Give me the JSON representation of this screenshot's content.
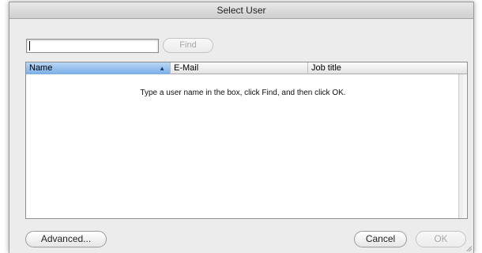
{
  "window": {
    "title": "Select User"
  },
  "search": {
    "value": "",
    "placeholder": ""
  },
  "buttons": {
    "find": "Find",
    "advanced": "Advanced...",
    "cancel": "Cancel",
    "ok": "OK"
  },
  "table": {
    "columns": [
      {
        "label": "Name",
        "sorted": true
      },
      {
        "label": "E-Mail",
        "sorted": false
      },
      {
        "label": "Job title",
        "sorted": false
      }
    ],
    "hint": "Type a user name in the box, click Find, and then click OK."
  },
  "colors": {
    "sorted_header": "#7aaee8",
    "disabled_text": "#a8a8a8"
  },
  "icons": {
    "sort": "sort-ascending-icon",
    "resize": "resize-grip-icon"
  }
}
